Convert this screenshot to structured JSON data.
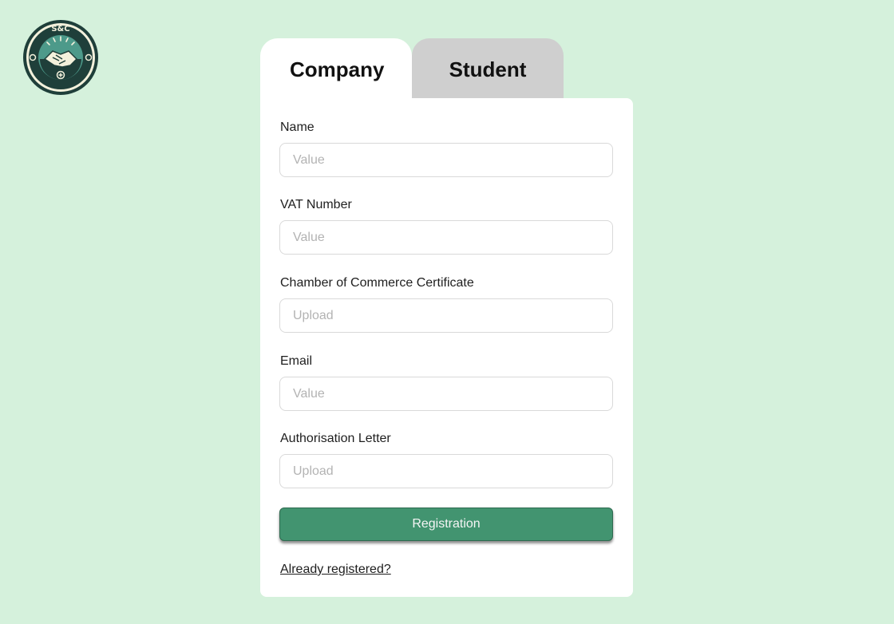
{
  "logo": {
    "text": "S&C",
    "colors": {
      "ring": "#1f3f3a",
      "teal": "#4d9a8a",
      "cream": "#f3f1dc"
    }
  },
  "tabs": {
    "company": "Company",
    "student": "Student",
    "active": "company"
  },
  "form": {
    "fields": [
      {
        "label": "Name",
        "placeholder": "Value"
      },
      {
        "label": "VAT Number",
        "placeholder": "Value"
      },
      {
        "label": "Chamber of Commerce Certificate",
        "placeholder": "Upload"
      },
      {
        "label": "Email",
        "placeholder": "Value"
      },
      {
        "label": "Authorisation Letter",
        "placeholder": "Upload"
      }
    ],
    "submit_label": "Registration",
    "login_link": "Already registered?"
  },
  "colors": {
    "background": "#d5f1dc",
    "primary_button": "#429470",
    "inactive_tab": "#cfcfcf"
  }
}
